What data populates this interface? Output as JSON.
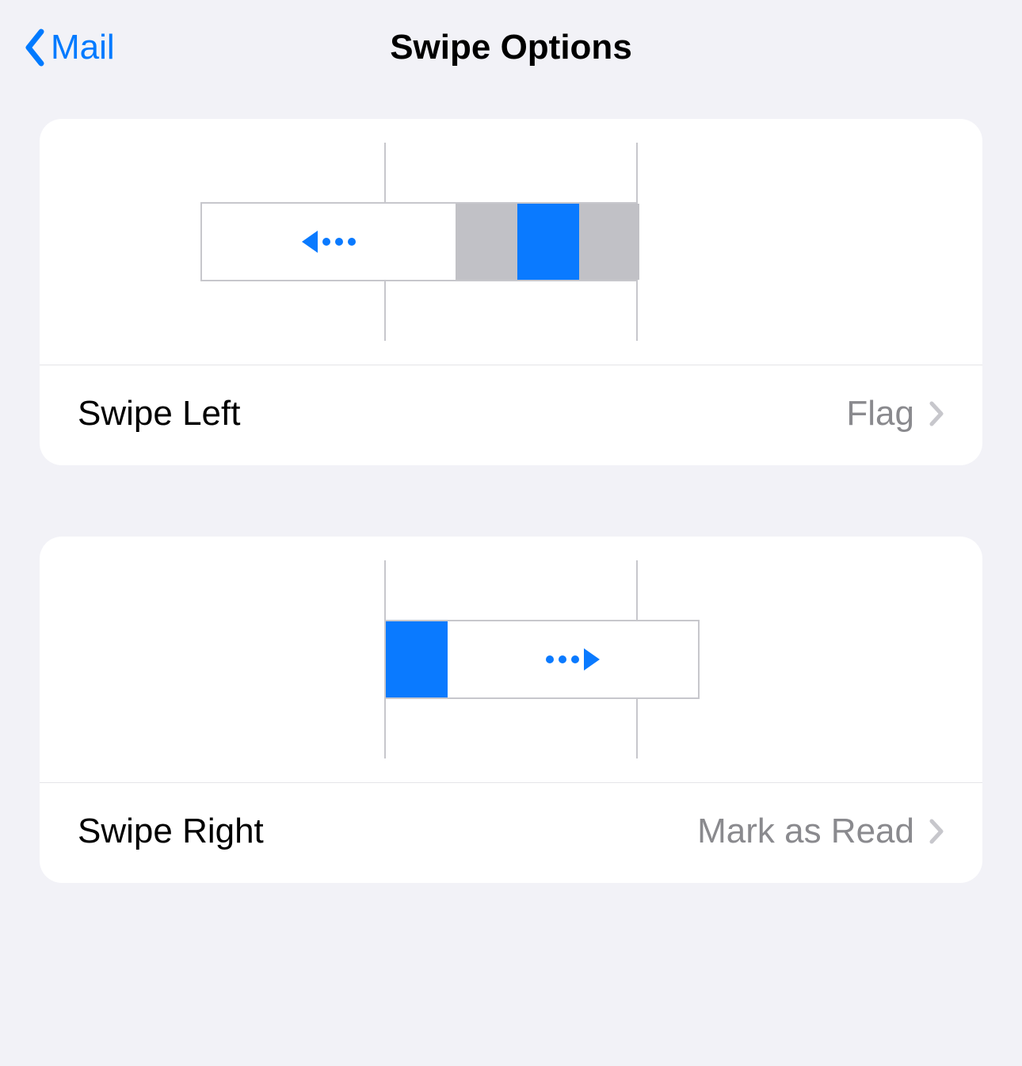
{
  "header": {
    "back_label": "Mail",
    "title": "Swipe Options"
  },
  "sections": {
    "swipe_left": {
      "label": "Swipe Left",
      "value": "Flag"
    },
    "swipe_right": {
      "label": "Swipe Right",
      "value": "Mark as Read"
    }
  },
  "colors": {
    "accent": "#007aff",
    "preview_blue": "#0a7aff",
    "preview_gray": "#c1c1c6"
  }
}
